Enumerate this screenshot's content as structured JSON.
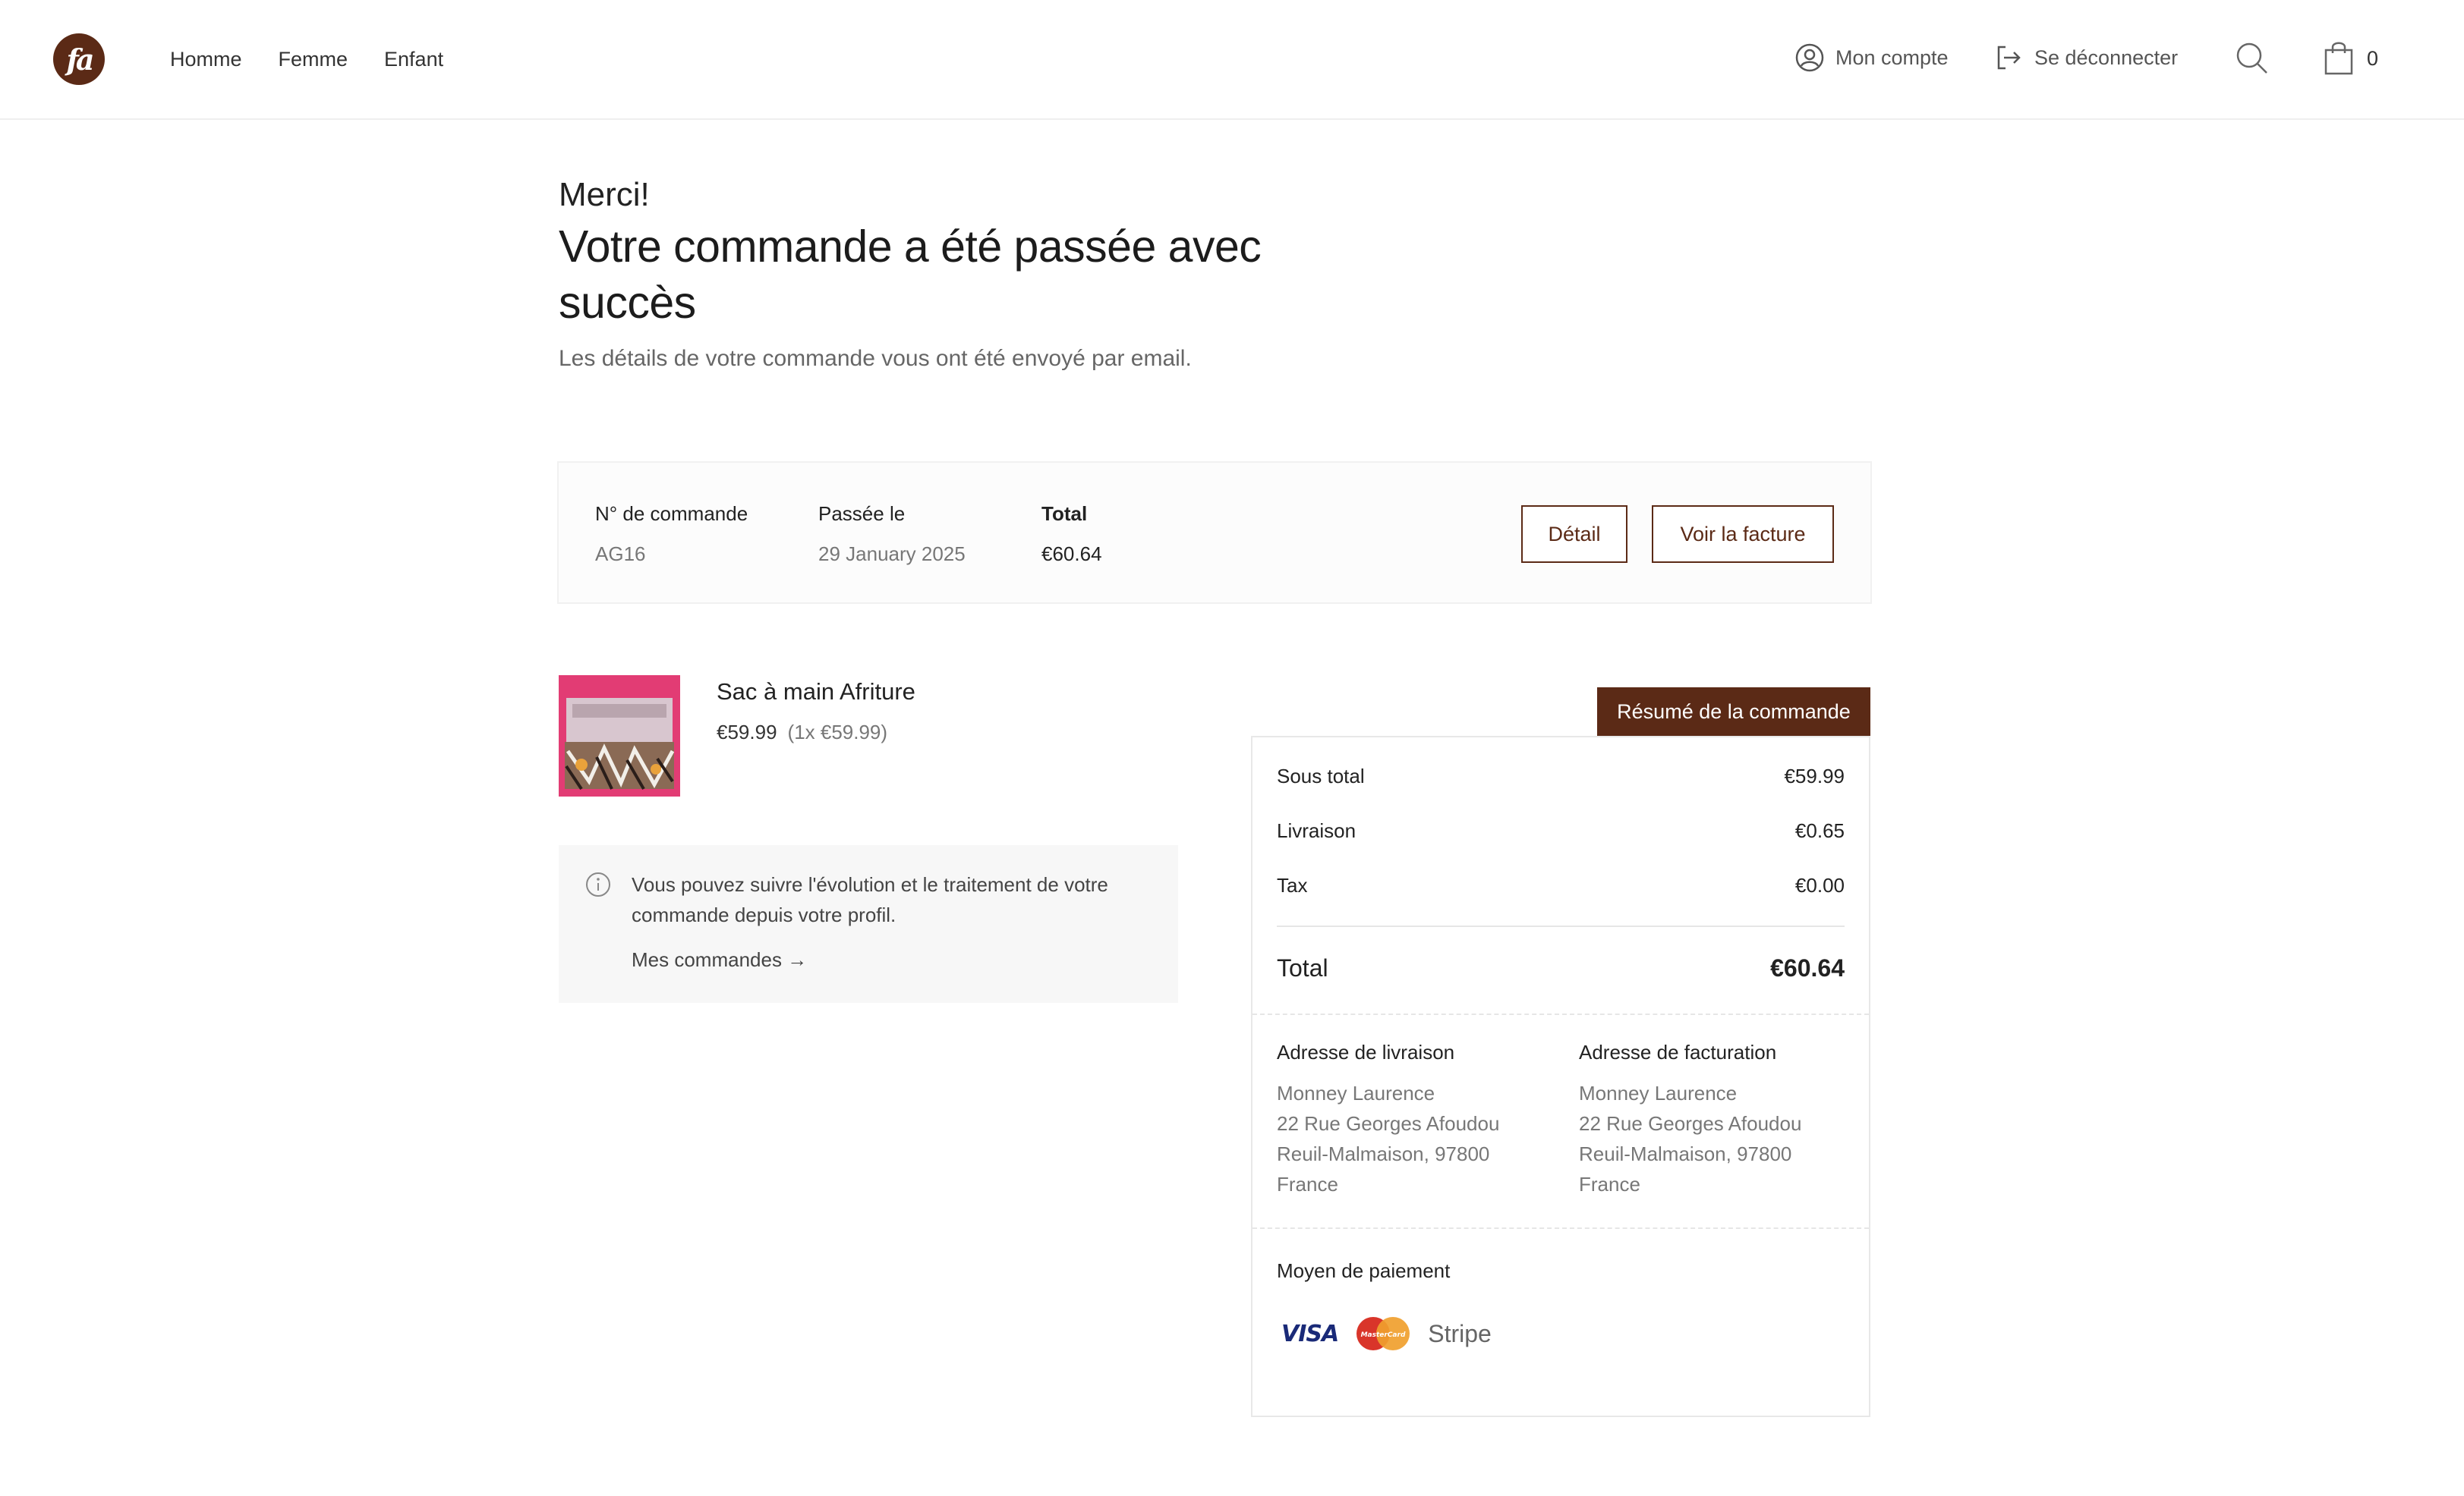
{
  "header": {
    "logo_text": "fa",
    "nav": [
      "Homme",
      "Femme",
      "Enfant"
    ],
    "account_label": "Mon compte",
    "logout_label": "Se déconnecter",
    "cart_count": "0"
  },
  "confirmation": {
    "merci": "Merci!",
    "title": "Votre commande a été passée avec succès",
    "subtitle": "Les détails de votre commande vous ont été envoyé par email."
  },
  "order": {
    "number_label": "N° de commande",
    "number_value": "AG16",
    "date_label": "Passée le",
    "date_value": "29 January 2025",
    "total_label": "Total",
    "total_value": "€60.64",
    "detail_button": "Détail",
    "invoice_button": "Voir la facture"
  },
  "product": {
    "name": "Sac à main Afriture",
    "price": "€59.99",
    "qty_price": "(1x €59.99)"
  },
  "notice": {
    "text": "Vous pouvez suivre l'évolution et le traitement de votre commande depuis votre profil.",
    "link": "Mes commandes →"
  },
  "summary": {
    "tag": "Résumé de la commande",
    "subtotal_label": "Sous total",
    "subtotal_value": "€59.99",
    "shipping_label": "Livraison",
    "shipping_value": "€0.65",
    "tax_label": "Tax",
    "tax_value": "€0.00",
    "total_label": "Total",
    "total_value": "€60.64",
    "shipping_address": {
      "title": "Adresse de livraison",
      "name": "Monney Laurence",
      "street": "22 Rue Georges Afoudou",
      "city": "Reuil-Malmaison, 97800",
      "country": "France"
    },
    "billing_address": {
      "title": "Adresse de facturation",
      "name": "Monney Laurence",
      "street": "22 Rue Georges Afoudou",
      "city": "Reuil-Malmaison, 97800",
      "country": "France"
    },
    "payment_title": "Moyen de paiement",
    "payment_visa": "VISA",
    "payment_mastercard": "MasterCard",
    "payment_provider": "Stripe"
  },
  "colors": {
    "brand": "#5b2a16",
    "product_bg": "#e23c74"
  }
}
